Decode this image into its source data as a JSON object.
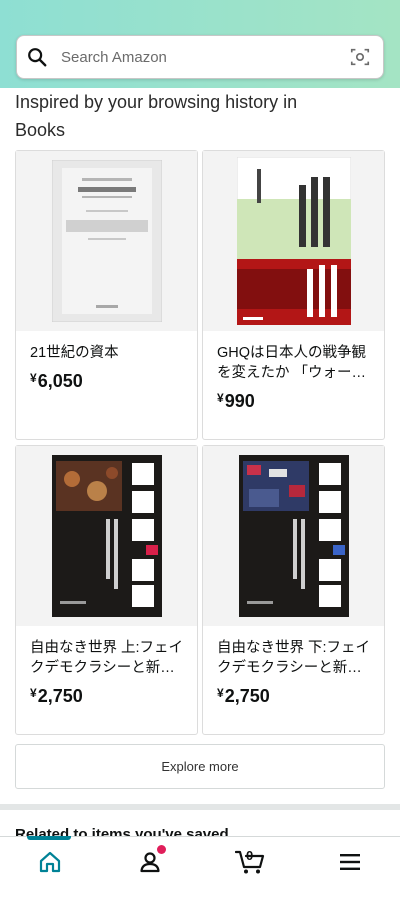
{
  "search": {
    "placeholder": "Search Amazon"
  },
  "section": {
    "title": "Inspired by your browsing history in Books"
  },
  "products": [
    {
      "title": "21世紀の資本",
      "currency": "¥",
      "price": "6,050"
    },
    {
      "title": "GHQは日本人の戦争観を変えたか 「ウォー・ギ…",
      "currency": "¥",
      "price": "990"
    },
    {
      "title": "自由なき世界 上:フェイクデモクラシーと新たなフ…",
      "currency": "¥",
      "price": "2,750"
    },
    {
      "title": "自由なき世界 下:フェイクデモクラシーと新たなフ…",
      "currency": "¥",
      "price": "2,750"
    }
  ],
  "explore": {
    "label": "Explore more"
  },
  "related": {
    "title": "Related to items you've saved"
  },
  "nav": {
    "cart_count": "0"
  },
  "colors": {
    "accent": "#008296",
    "notification": "#e01e5a",
    "header_start": "#8edfd3",
    "header_end": "#a4e4c4"
  },
  "icons": [
    "search-icon",
    "camera-icon",
    "home-icon",
    "account-icon",
    "cart-icon",
    "menu-icon"
  ]
}
